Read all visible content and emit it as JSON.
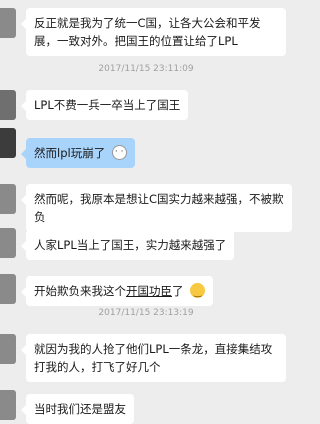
{
  "messages": [
    {
      "text": "反正就是我为了统一C国，让各大公会和平发展，一致对外。把国王的位置让给了LPL"
    },
    {
      "text": "LPL不费一兵一卒当上了国王"
    },
    {
      "text": "然而lpl玩崩了"
    },
    {
      "text": "然而呢，我原本是想让C国实力越来越强，不被欺负"
    },
    {
      "text": "人家LPL当上了国王，实力越来越强了"
    },
    {
      "text_a": "开始欺负来我这个",
      "text_b": "开国功臣",
      "text_c": "了"
    },
    {
      "text": "就因为我的人抢了他们LPL一条龙，直接集结攻打我的人，打飞了好几个"
    },
    {
      "text": "当时我们还是盟友"
    }
  ],
  "timestamps": [
    "2017/11/15 23:11:09",
    "2017/11/15 23:13:19"
  ],
  "colors": {
    "background": "#ededed",
    "bubble": "#ffffff",
    "bubble_highlight": "#a8d3fb",
    "timestamp": "#a0a0a0"
  },
  "icons": {
    "cat_emoji": "cat-face-emoji",
    "smile_emoji": "smiley-emoji"
  }
}
